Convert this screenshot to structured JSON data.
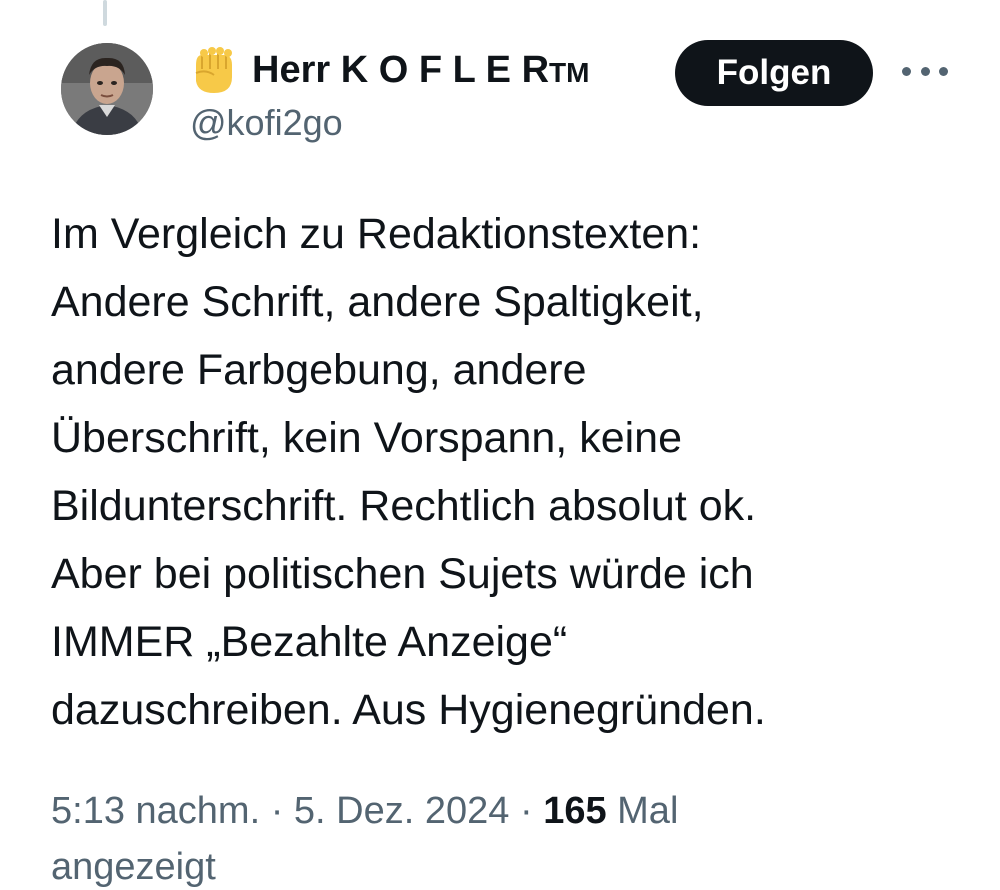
{
  "tweet": {
    "author": {
      "display_name": "Herr K O F L E R",
      "tm": "TM",
      "handle": "@kofi2go",
      "avatar_icon": "person-portrait",
      "name_icon": "raised-fist-emoji"
    },
    "follow_label": "Folgen",
    "more_icon": "three-dots-icon",
    "text_lines": [
      "Im Vergleich zu Redaktionstexten:",
      "Andere Schrift, andere Spaltigkeit,",
      "andere Farbgebung, andere",
      "Überschrift, kein Vorspann, keine",
      "Bildunterschrift. Rechtlich absolut ok.",
      "Aber bei politischen Sujets würde ich",
      "IMMER „Bezahlte Anzeige“",
      "dazuschreiben. Aus Hygienegründen."
    ],
    "meta": {
      "time": "5:13 nachm.",
      "separator": " · ",
      "date": "5. Dez. 2024",
      "views_count": "165",
      "views_suffix": " Mal",
      "views_line2": "angezeigt"
    }
  },
  "colors": {
    "text": "#0f1419",
    "secondary": "#536471",
    "button_bg": "#0f1419",
    "button_text": "#ffffff",
    "emoji_yellow": "#f7c948"
  }
}
